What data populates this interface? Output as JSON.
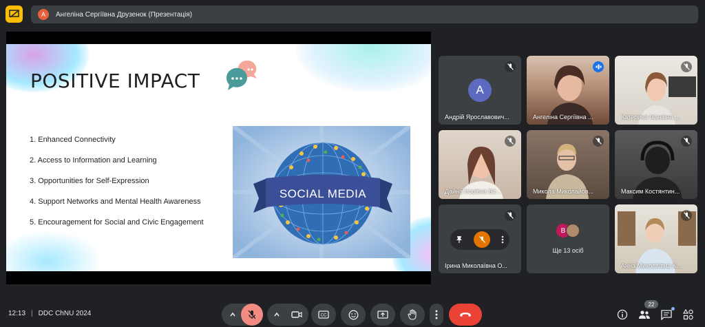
{
  "presentation": {
    "presenter_initial": "А",
    "title": "Ангеліна Сергіївна Друзенок (Презентація)"
  },
  "slide": {
    "title": "POSITIVE IMPACT",
    "items": [
      "1. Enhanced Connectivity",
      "2. Access to Information and Learning",
      "3. Opportunities for Self-Expression",
      "4. Support Networks and Mental Health Awareness",
      "5. Encouragement for Social and Civic Engagement"
    ],
    "image_banner": "SOCIAL MEDIA"
  },
  "participants": [
    {
      "name": "Андрій Ярославович...",
      "initial": "А",
      "mic": "muted"
    },
    {
      "name": "Ангеліна Сергіївна ...",
      "mic": "speaking"
    },
    {
      "name": "Катерина Іванівна ...",
      "mic": "muted"
    },
    {
      "name": "Дайна Ігорівна Біг...",
      "mic": "muted"
    },
    {
      "name": "Микола Миколайов...",
      "mic": "muted"
    },
    {
      "name": "Максим Костянтин...",
      "mic": "muted"
    },
    {
      "name": "Ірина Миколаївна О...",
      "mic": "muted"
    },
    {
      "name": "Ще 13 осіб",
      "initial": "В"
    },
    {
      "name": "Анна Миколаївна К...",
      "mic": "muted"
    }
  ],
  "bottom": {
    "time": "12:13",
    "meeting_name": "DDC ChNU 2024",
    "people_count": "22"
  },
  "colors": {
    "background": "#202124",
    "tile": "#3c4043",
    "accent": "#8ab4f8",
    "end_call": "#ea4335",
    "mic_off": "#f28b82",
    "presenting": "#fbbc04"
  }
}
